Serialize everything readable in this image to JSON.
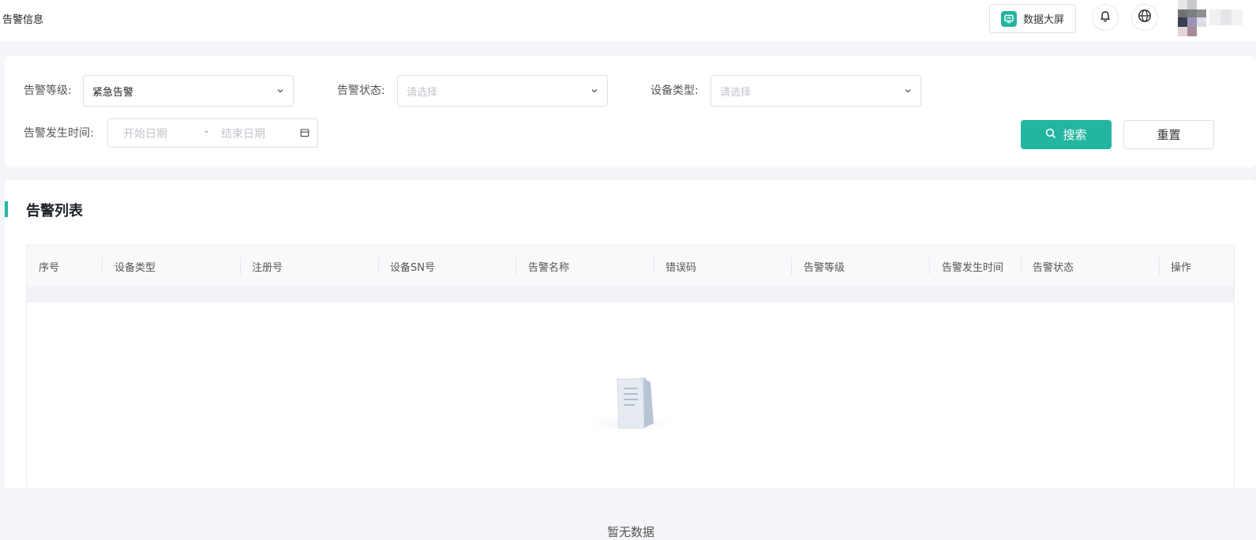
{
  "header": {
    "title": "告警信息",
    "bigscreen_label": "数据大屏",
    "icons": {
      "monitor": "monitor-icon",
      "bell": "bell-icon",
      "globe": "globe-icon"
    }
  },
  "filters": {
    "level_label": "告警等级:",
    "level_value": "紧急告警",
    "status_label": "告警状态:",
    "status_placeholder": "请选择",
    "device_type_label": "设备类型:",
    "device_type_placeholder": "请选择",
    "time_label": "告警发生时间:",
    "start_placeholder": "开始日期",
    "range_sep": "-",
    "end_placeholder": "结束日期",
    "search_label": "搜索",
    "reset_label": "重置"
  },
  "list": {
    "title": "告警列表",
    "columns": [
      "序号",
      "设备类型",
      "注册号",
      "设备SN号",
      "告警名称",
      "错误码",
      "告警等级",
      "告警发生时间",
      "告警状态",
      "操作"
    ],
    "empty_text": "暂无数据"
  },
  "colors": {
    "accent": "#23b5a0",
    "page_bg": "#f4f5f8",
    "border": "#dcdfe6"
  }
}
